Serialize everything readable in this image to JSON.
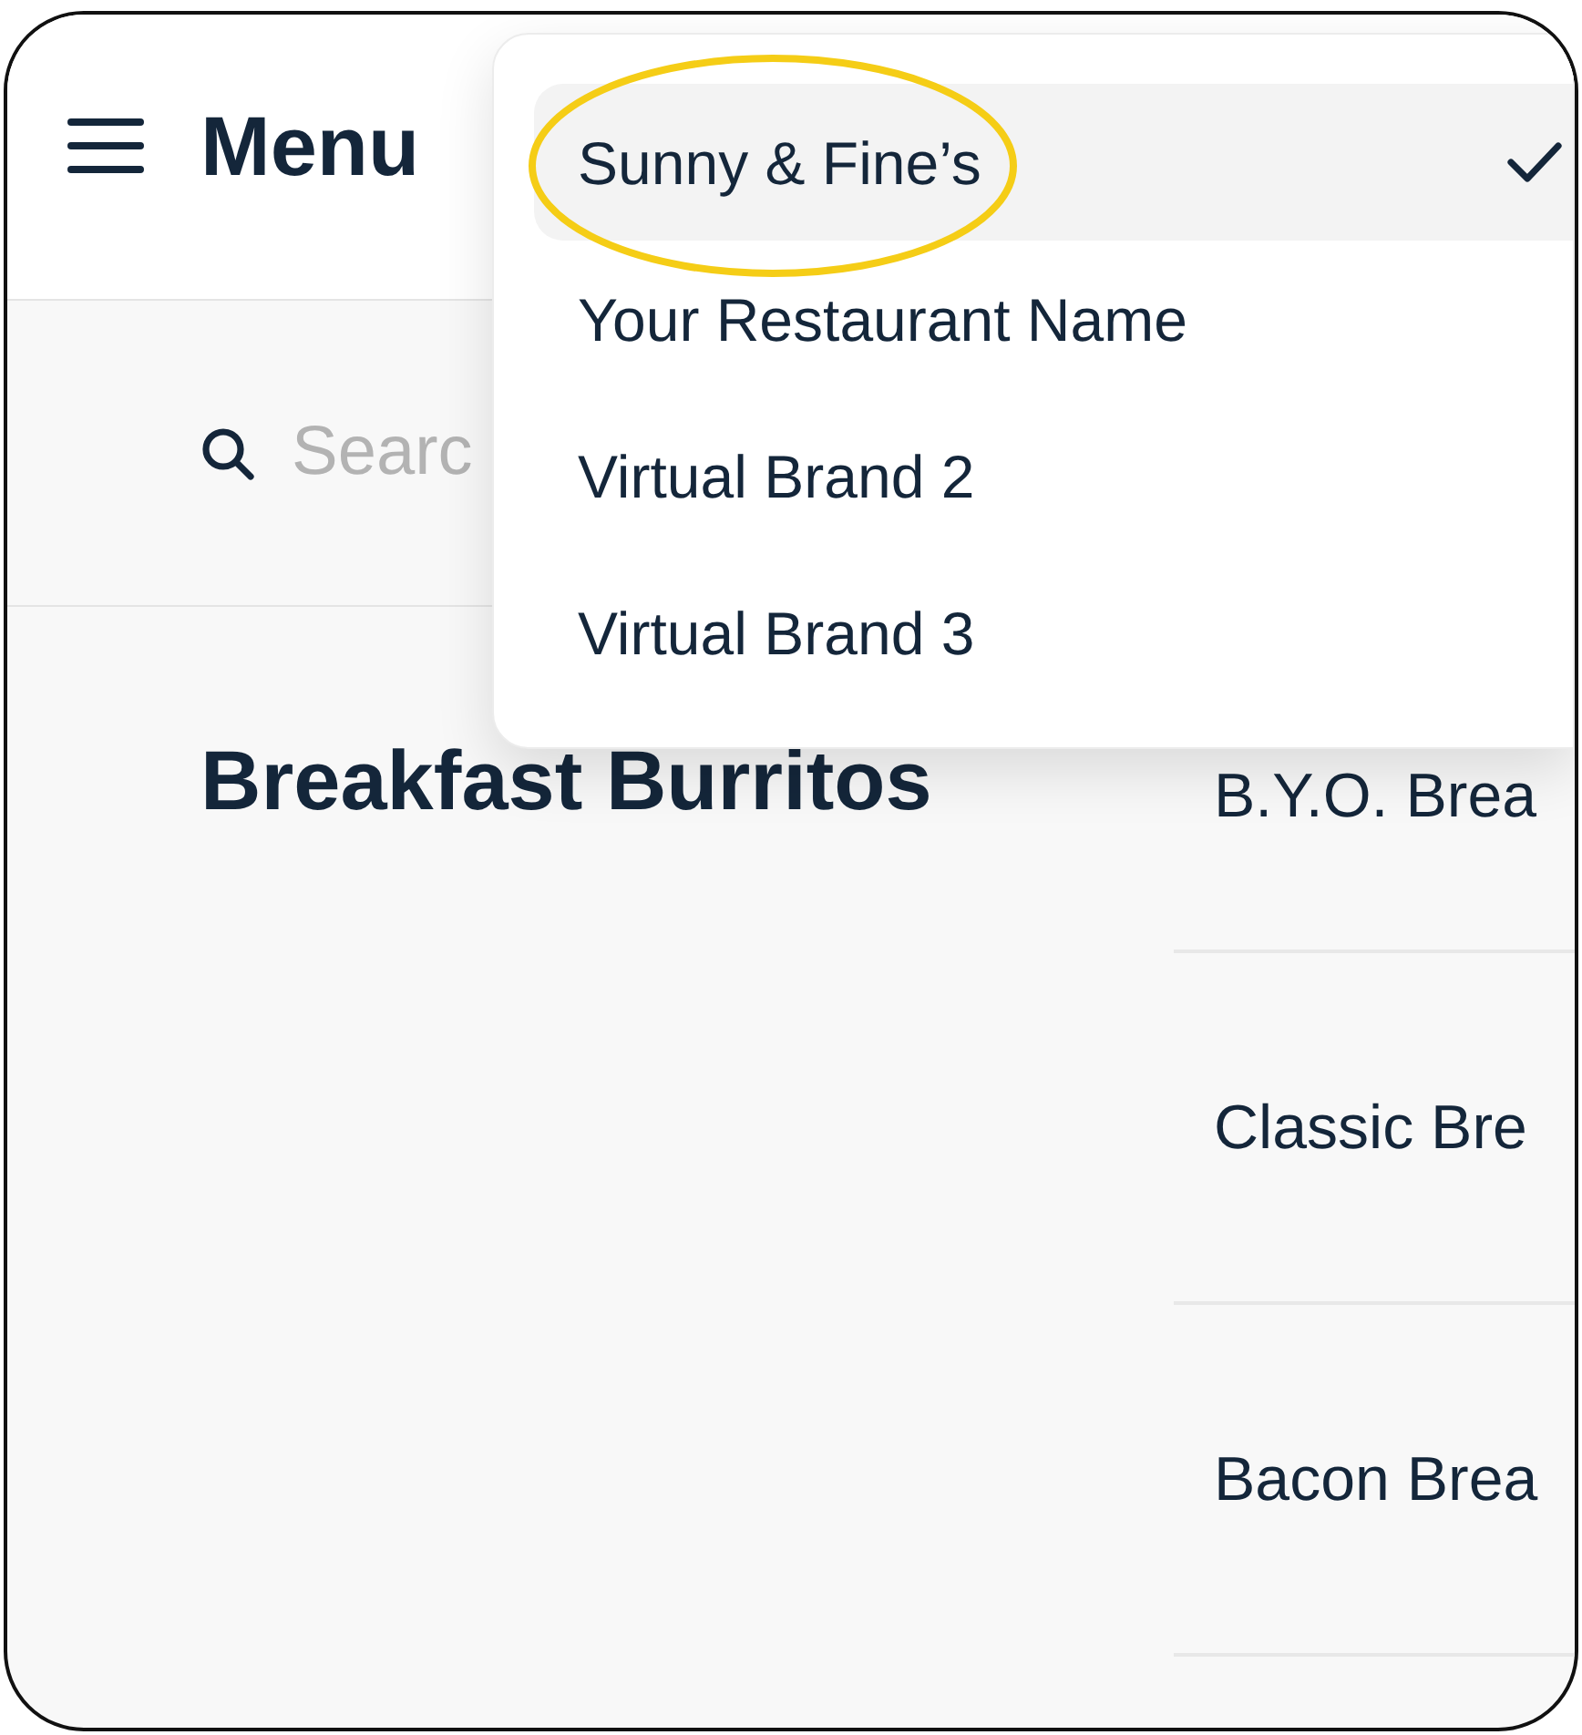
{
  "header": {
    "title": "Menu"
  },
  "search": {
    "placeholder": "Searc"
  },
  "category": {
    "title": "Breakfast Burritos"
  },
  "items": [
    {
      "name": "B.Y.O. Brea"
    },
    {
      "name": "Classic Bre"
    },
    {
      "name": "Bacon Brea"
    }
  ],
  "brand_dropdown": {
    "items": [
      {
        "label": "Sunny & Fine’s",
        "selected": true,
        "circled": true
      },
      {
        "label": "Your Restaurant Name",
        "selected": false,
        "circled": false
      },
      {
        "label": "Virtual Brand 2",
        "selected": false,
        "circled": false
      },
      {
        "label": "Virtual Brand 3",
        "selected": false,
        "circled": false
      }
    ]
  }
}
